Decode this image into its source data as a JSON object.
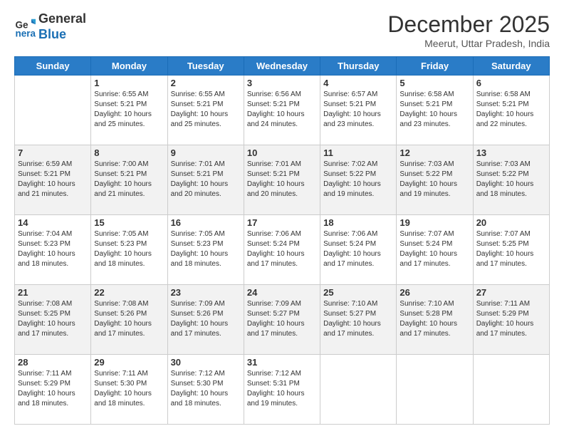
{
  "header": {
    "logo_line1": "General",
    "logo_line2": "Blue",
    "month": "December 2025",
    "location": "Meerut, Uttar Pradesh, India"
  },
  "days_of_week": [
    "Sunday",
    "Monday",
    "Tuesday",
    "Wednesday",
    "Thursday",
    "Friday",
    "Saturday"
  ],
  "weeks": [
    [
      {
        "day": "",
        "info": ""
      },
      {
        "day": "1",
        "info": "Sunrise: 6:55 AM\nSunset: 5:21 PM\nDaylight: 10 hours\nand 25 minutes."
      },
      {
        "day": "2",
        "info": "Sunrise: 6:55 AM\nSunset: 5:21 PM\nDaylight: 10 hours\nand 25 minutes."
      },
      {
        "day": "3",
        "info": "Sunrise: 6:56 AM\nSunset: 5:21 PM\nDaylight: 10 hours\nand 24 minutes."
      },
      {
        "day": "4",
        "info": "Sunrise: 6:57 AM\nSunset: 5:21 PM\nDaylight: 10 hours\nand 23 minutes."
      },
      {
        "day": "5",
        "info": "Sunrise: 6:58 AM\nSunset: 5:21 PM\nDaylight: 10 hours\nand 23 minutes."
      },
      {
        "day": "6",
        "info": "Sunrise: 6:58 AM\nSunset: 5:21 PM\nDaylight: 10 hours\nand 22 minutes."
      }
    ],
    [
      {
        "day": "7",
        "info": "Sunrise: 6:59 AM\nSunset: 5:21 PM\nDaylight: 10 hours\nand 21 minutes."
      },
      {
        "day": "8",
        "info": "Sunrise: 7:00 AM\nSunset: 5:21 PM\nDaylight: 10 hours\nand 21 minutes."
      },
      {
        "day": "9",
        "info": "Sunrise: 7:01 AM\nSunset: 5:21 PM\nDaylight: 10 hours\nand 20 minutes."
      },
      {
        "day": "10",
        "info": "Sunrise: 7:01 AM\nSunset: 5:21 PM\nDaylight: 10 hours\nand 20 minutes."
      },
      {
        "day": "11",
        "info": "Sunrise: 7:02 AM\nSunset: 5:22 PM\nDaylight: 10 hours\nand 19 minutes."
      },
      {
        "day": "12",
        "info": "Sunrise: 7:03 AM\nSunset: 5:22 PM\nDaylight: 10 hours\nand 19 minutes."
      },
      {
        "day": "13",
        "info": "Sunrise: 7:03 AM\nSunset: 5:22 PM\nDaylight: 10 hours\nand 18 minutes."
      }
    ],
    [
      {
        "day": "14",
        "info": "Sunrise: 7:04 AM\nSunset: 5:23 PM\nDaylight: 10 hours\nand 18 minutes."
      },
      {
        "day": "15",
        "info": "Sunrise: 7:05 AM\nSunset: 5:23 PM\nDaylight: 10 hours\nand 18 minutes."
      },
      {
        "day": "16",
        "info": "Sunrise: 7:05 AM\nSunset: 5:23 PM\nDaylight: 10 hours\nand 18 minutes."
      },
      {
        "day": "17",
        "info": "Sunrise: 7:06 AM\nSunset: 5:24 PM\nDaylight: 10 hours\nand 17 minutes."
      },
      {
        "day": "18",
        "info": "Sunrise: 7:06 AM\nSunset: 5:24 PM\nDaylight: 10 hours\nand 17 minutes."
      },
      {
        "day": "19",
        "info": "Sunrise: 7:07 AM\nSunset: 5:24 PM\nDaylight: 10 hours\nand 17 minutes."
      },
      {
        "day": "20",
        "info": "Sunrise: 7:07 AM\nSunset: 5:25 PM\nDaylight: 10 hours\nand 17 minutes."
      }
    ],
    [
      {
        "day": "21",
        "info": "Sunrise: 7:08 AM\nSunset: 5:25 PM\nDaylight: 10 hours\nand 17 minutes."
      },
      {
        "day": "22",
        "info": "Sunrise: 7:08 AM\nSunset: 5:26 PM\nDaylight: 10 hours\nand 17 minutes."
      },
      {
        "day": "23",
        "info": "Sunrise: 7:09 AM\nSunset: 5:26 PM\nDaylight: 10 hours\nand 17 minutes."
      },
      {
        "day": "24",
        "info": "Sunrise: 7:09 AM\nSunset: 5:27 PM\nDaylight: 10 hours\nand 17 minutes."
      },
      {
        "day": "25",
        "info": "Sunrise: 7:10 AM\nSunset: 5:27 PM\nDaylight: 10 hours\nand 17 minutes."
      },
      {
        "day": "26",
        "info": "Sunrise: 7:10 AM\nSunset: 5:28 PM\nDaylight: 10 hours\nand 17 minutes."
      },
      {
        "day": "27",
        "info": "Sunrise: 7:11 AM\nSunset: 5:29 PM\nDaylight: 10 hours\nand 17 minutes."
      }
    ],
    [
      {
        "day": "28",
        "info": "Sunrise: 7:11 AM\nSunset: 5:29 PM\nDaylight: 10 hours\nand 18 minutes."
      },
      {
        "day": "29",
        "info": "Sunrise: 7:11 AM\nSunset: 5:30 PM\nDaylight: 10 hours\nand 18 minutes."
      },
      {
        "day": "30",
        "info": "Sunrise: 7:12 AM\nSunset: 5:30 PM\nDaylight: 10 hours\nand 18 minutes."
      },
      {
        "day": "31",
        "info": "Sunrise: 7:12 AM\nSunset: 5:31 PM\nDaylight: 10 hours\nand 19 minutes."
      },
      {
        "day": "",
        "info": ""
      },
      {
        "day": "",
        "info": ""
      },
      {
        "day": "",
        "info": ""
      }
    ]
  ]
}
